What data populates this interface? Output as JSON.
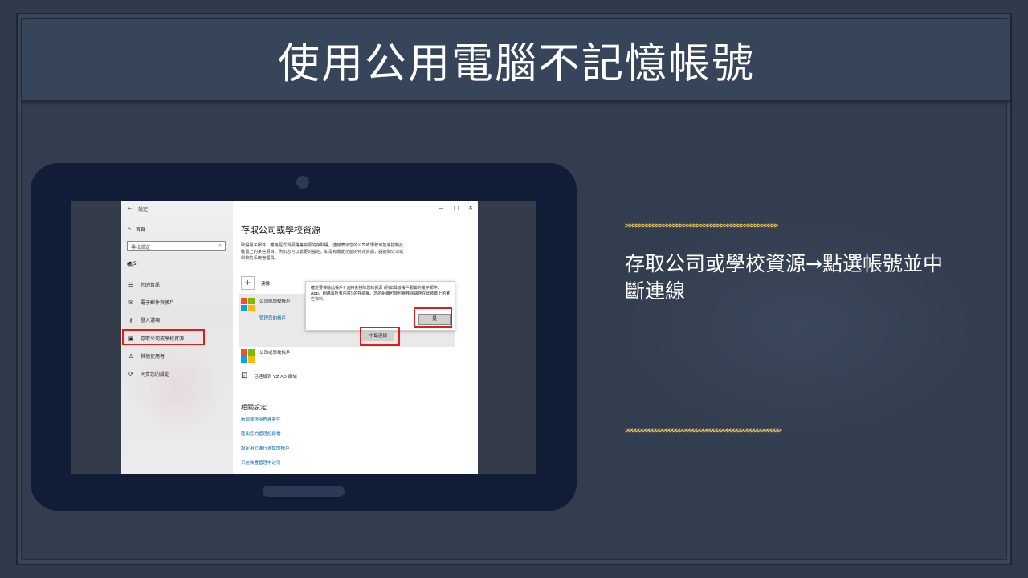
{
  "slide": {
    "title": "使用公用電腦不記憶帳號",
    "description": "存取公司或學校資源→點選帳號並中斷連線",
    "arrows_top": ">>>>>>>>>>>>>>>>>>>>>>>>>>>>>>>>>>>>>>>>>>>>>",
    "arrows_bottom": ">>>>>>>>>>>>>>>>>>>>>>>>>>>>>>>>>>>>>>>>>>>>>>"
  },
  "colors": {
    "highlight": "#e21b1b",
    "arrow_accent": "#f0c45a",
    "tablet": "#111d36",
    "link": "#0063b1"
  },
  "window": {
    "back_icon": "back-arrow-icon",
    "title": "設定",
    "controls": [
      "—",
      "□",
      "✕"
    ]
  },
  "sidebar": {
    "home_label": "首頁",
    "search_placeholder": "尋找設定",
    "section": "帳戶",
    "items": [
      {
        "icon": "person-card-icon",
        "label": "您的資訊"
      },
      {
        "icon": "mail-icon",
        "label": "電子郵件與帳戶"
      },
      {
        "icon": "key-icon",
        "label": "登入選項"
      },
      {
        "icon": "briefcase-icon",
        "label": "存取公司或學校資源"
      },
      {
        "icon": "person-icon",
        "label": "其他使用者"
      },
      {
        "icon": "sync-icon",
        "label": "同步您的設定"
      }
    ]
  },
  "main": {
    "title": "存取公司或學校資源",
    "description": "取得電子郵件、應用程式與網路等資源的存取權。連線表示您的公司或學校可能會控制此裝置上的某些項目，例如您可以變更的設定。如需有關此功能的特定資訊，請詢問公司或學校的系統管理員。",
    "connect_label": "連線",
    "account1_label": "公司或學校帳戶",
    "account1_link": "管理您的帳戶",
    "dialog_text": "確定要移除此帳戶? 這將會移除您的資源 (例如與該帳戶關聯的電子郵件、App、網路與所有內容) 的存取權。您的組織可能也會移除儲存在此裝置上的某些資料。",
    "yes_button": "是",
    "disconnect_button": "中斷連線",
    "account2_label": "公司或學校帳戶",
    "ad_label": "已連線到 YZ AD 網域",
    "related_title": "相關設定",
    "related_links": [
      "新增或移除佈建套件",
      "匯出您的管理記錄檔",
      "設定用於進行測試的帳戶",
      "只在裝置管理中註冊"
    ]
  }
}
